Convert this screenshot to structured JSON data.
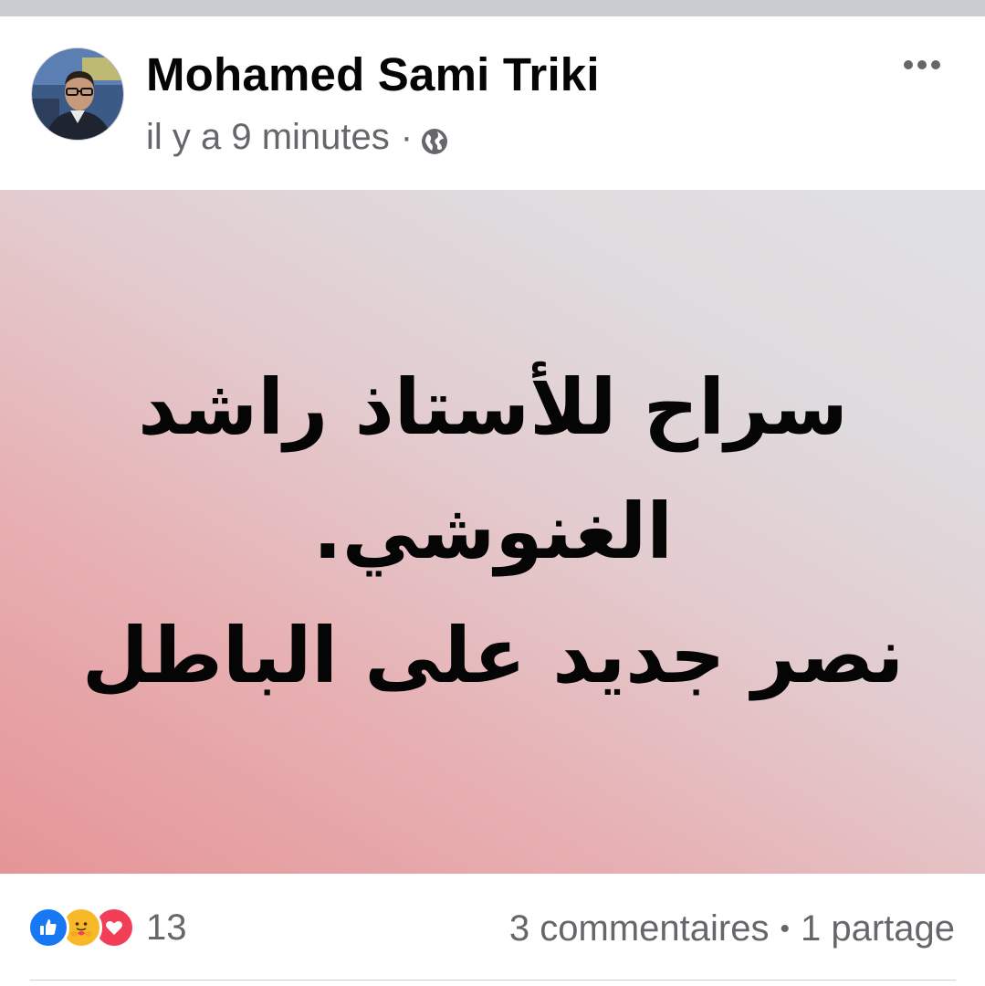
{
  "post": {
    "author_name": "Mohamed Sami Triki",
    "timestamp": "il y a 9 minutes",
    "separator": "·",
    "audience_icon": "globe-icon",
    "more_icon": "more-options-icon",
    "body_lines": [
      "سراح للأستاذ راشد",
      "الغنوشي.",
      "نصر جديد على الباطل"
    ],
    "background_colors": [
      "#e59597",
      "#e1e1e3"
    ]
  },
  "footer": {
    "reaction_icons": [
      "like-icon",
      "care-icon",
      "love-icon"
    ],
    "reaction_count": "13",
    "comments": "3 commentaires",
    "bullet": "•",
    "shares": "1 partage"
  },
  "colors": {
    "primary_text": "#050505",
    "secondary_text": "#65676b",
    "like_blue": "#1877f2",
    "love_red": "#f33e58",
    "care_yellow": "#f7b928"
  }
}
